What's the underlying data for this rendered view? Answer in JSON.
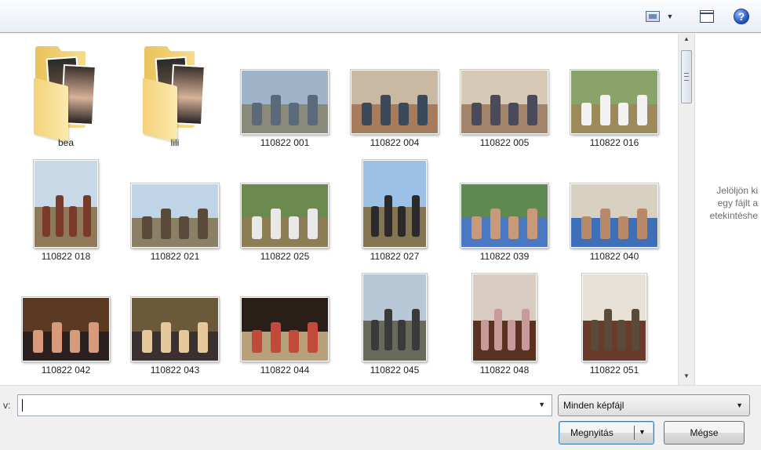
{
  "toolbar": {
    "view_icon": "change-view-icon",
    "view_dropdown_glyph": "▼",
    "preview_icon": "preview-pane-icon",
    "help_glyph": "?"
  },
  "files": {
    "items": [
      {
        "label": "bea",
        "kind": "folder"
      },
      {
        "label": "lili",
        "kind": "folder"
      },
      {
        "label": "110822 001",
        "kind": "photo",
        "sky": "#9fb4c8",
        "ground": "#8a8a7a",
        "fig": "#5a6a7a"
      },
      {
        "label": "110822 004",
        "kind": "photo",
        "sky": "#c9b9a2",
        "ground": "#a87c5a",
        "fig": "#3a4a5a"
      },
      {
        "label": "110822 005",
        "kind": "photo",
        "sky": "#d6c9b6",
        "ground": "#a2846a",
        "fig": "#4a4a5a"
      },
      {
        "label": "110822 016",
        "kind": "photo",
        "sky": "#8aa36a",
        "ground": "#9c8a5a",
        "fig": "#f2f2f2"
      },
      {
        "label": "110822 018",
        "kind": "photo",
        "sky": "#c8d8e6",
        "ground": "#8e7a5a",
        "fig": "#7a3a2a"
      },
      {
        "label": "110822 021",
        "kind": "photo",
        "sky": "#c0d4e8",
        "ground": "#8b8066",
        "fig": "#5a4a3a"
      },
      {
        "label": "110822 025",
        "kind": "photo",
        "sky": "#6c8a50",
        "ground": "#8d7d55",
        "fig": "#e8e8e8"
      },
      {
        "label": "110822 027",
        "kind": "photo",
        "sky": "#9cc0e6",
        "ground": "#837452",
        "fig": "#2a2a2a"
      },
      {
        "label": "110822 039",
        "kind": "photo",
        "sky": "#5e8a52",
        "ground": "#4a78c2",
        "fig": "#c89a7a"
      },
      {
        "label": "110822 040",
        "kind": "photo",
        "sky": "#d8d0c0",
        "ground": "#3f6fb8",
        "fig": "#b88a6a"
      },
      {
        "label": "110822 042",
        "kind": "photo",
        "sky": "#5a3a22",
        "ground": "#2a2020",
        "fig": "#d89a7a"
      },
      {
        "label": "110822 043",
        "kind": "photo",
        "sky": "#6a5a3a",
        "ground": "#3a3030",
        "fig": "#e6c89a"
      },
      {
        "label": "110822 044",
        "kind": "photo",
        "sky": "#2a1e18",
        "ground": "#b8a07a",
        "fig": "#c24a3a"
      },
      {
        "label": "110822 045",
        "kind": "photo",
        "sky": "#b8c8d6",
        "ground": "#6a6a5a",
        "fig": "#3a3a3a"
      },
      {
        "label": "110822 048",
        "kind": "photo",
        "sky": "#d8ccc0",
        "ground": "#5a3222",
        "fig": "#c99a9a"
      },
      {
        "label": "110822 051",
        "kind": "photo",
        "sky": "#e6e0d6",
        "ground": "#6a3a2a",
        "fig": "#5a4a3a"
      }
    ]
  },
  "preview": {
    "line1": "Jelöljön ki",
    "line2": "egy fájlt a",
    "line3": "etekintéshe"
  },
  "bottom": {
    "filename_label_fragment": "v:",
    "filename_value": "",
    "filter_value": "Minden képfájl",
    "open_label": "Megnyitás",
    "cancel_label": "Mégse"
  },
  "colors": {
    "toolbar_border": "#a0afc3",
    "accent_blue": "#3c7fb1",
    "help_blue": "#1d4fb8"
  }
}
